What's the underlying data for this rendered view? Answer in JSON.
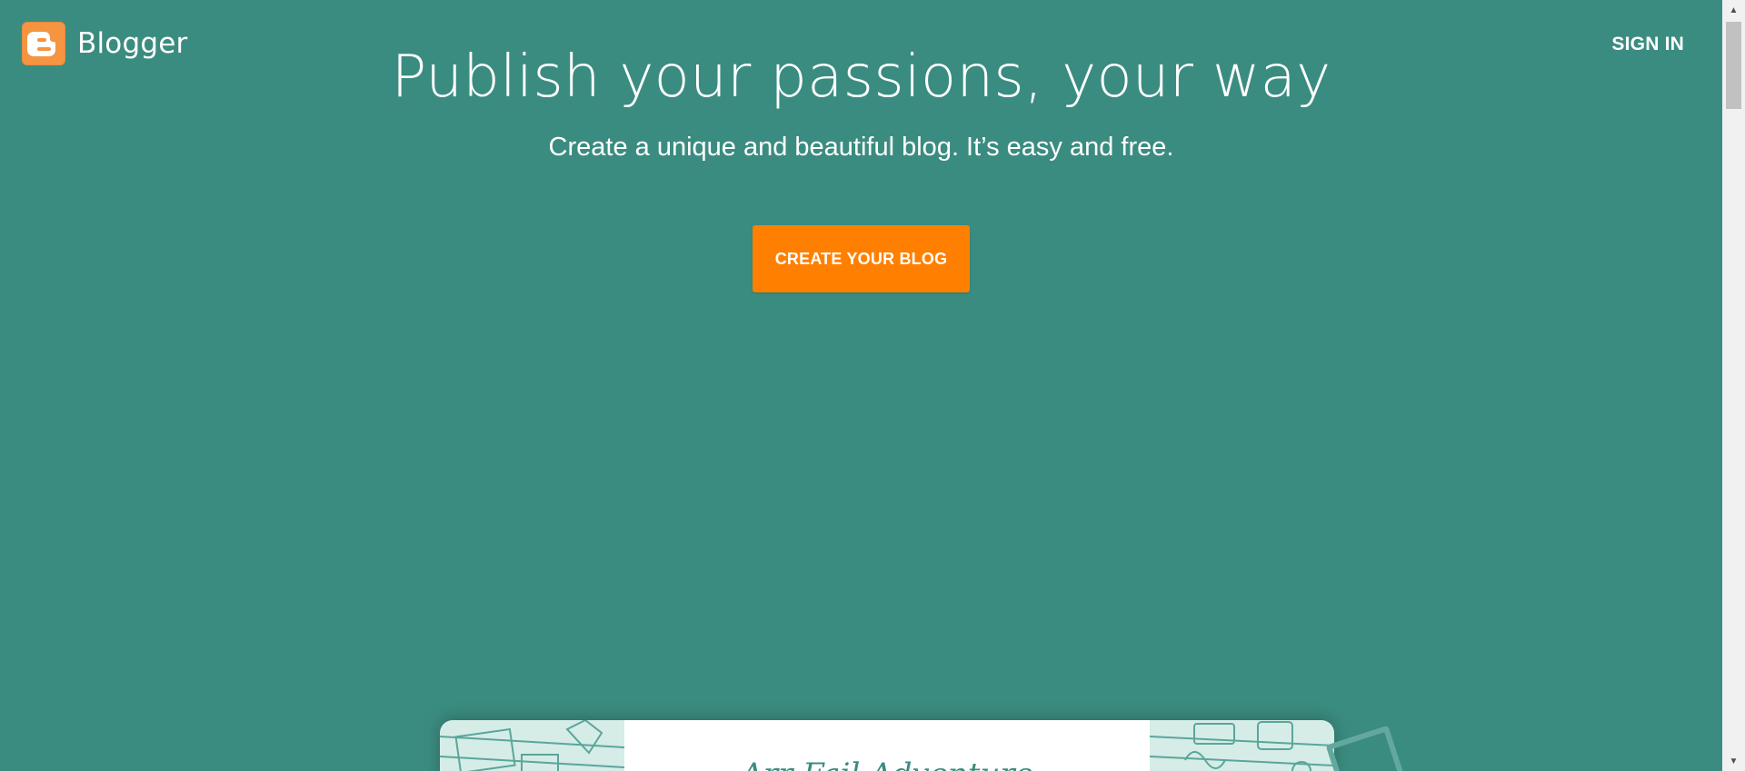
{
  "header": {
    "brand_name": "Blogger",
    "logo_icon": "blogger-logo-icon",
    "sign_in_label": "SIGN IN"
  },
  "hero": {
    "headline": "Publish your passions, your way",
    "subheadline": "Create a unique and beautiful blog. It’s easy and free.",
    "cta_label": "CREATE YOUR BLOG"
  },
  "preview": {
    "title_fragment": "Arr Fail Adventure"
  },
  "colors": {
    "background": "#3b8c80",
    "cta": "#ff8000",
    "logo": "#f59441",
    "text": "#ffffff"
  },
  "scrollbar": {
    "up_icon": "scroll-up-arrow-icon",
    "down_icon": "scroll-down-arrow-icon"
  }
}
